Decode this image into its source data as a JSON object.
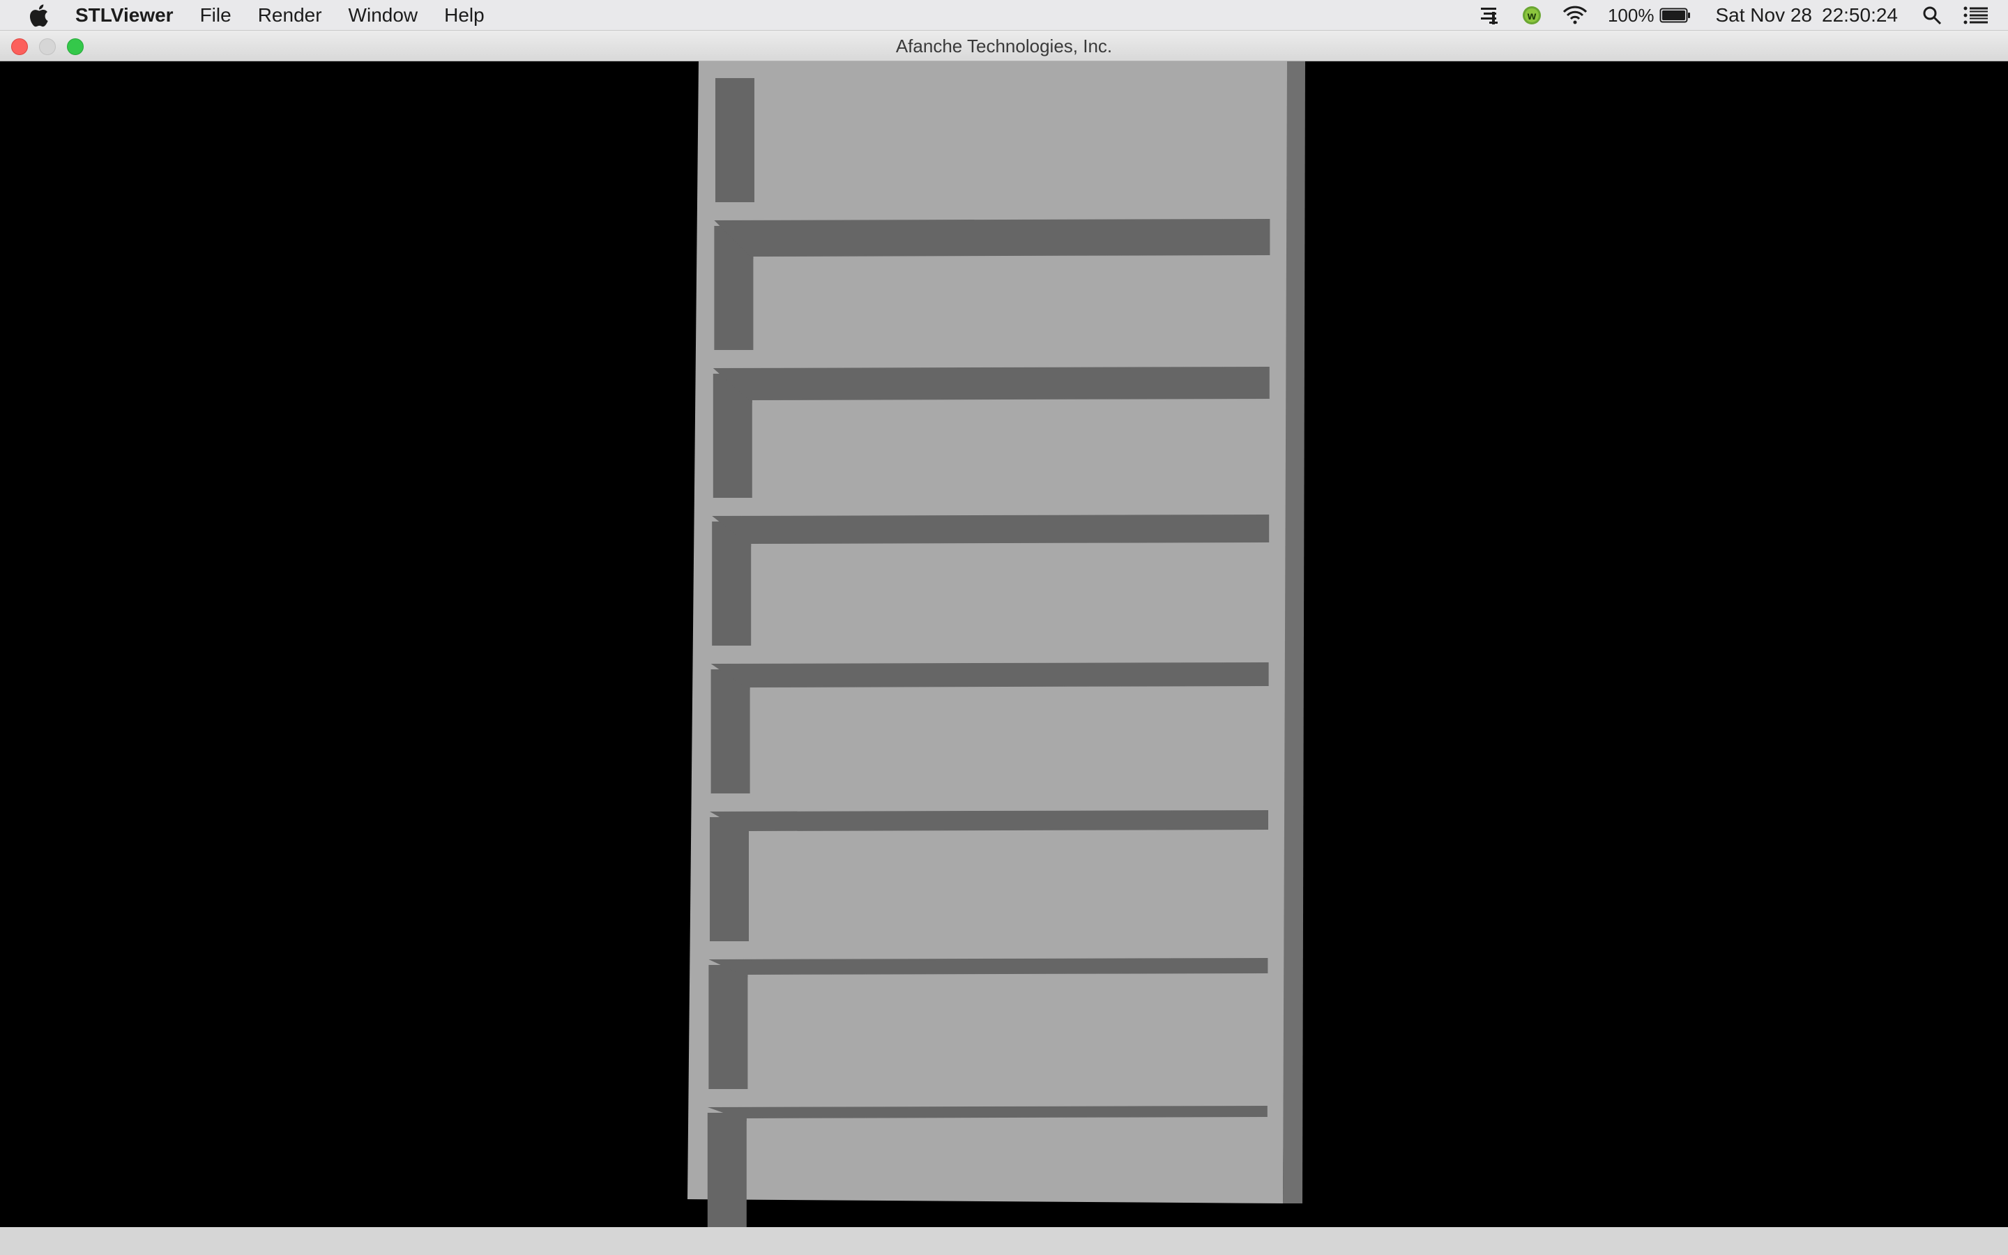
{
  "menubar": {
    "apple_icon": "apple-logo-icon",
    "app_name": "STLViewer",
    "items": [
      "File",
      "Render",
      "Window",
      "Help"
    ],
    "status": {
      "battery_percent": "100%",
      "date": "Sat Nov 28",
      "time": "22:50:24",
      "icons": [
        "cast-icon",
        "w-badge-icon",
        "wifi-icon",
        "battery-icon",
        "search-icon",
        "list-icon"
      ]
    }
  },
  "window": {
    "title": "Afanche Technologies, Inc."
  },
  "viewport": {
    "background": "#000000",
    "model_face_color": "#a9a9a9",
    "model_shade_color": "#666666",
    "model_edge_color": "#707070",
    "shelf_count": 8
  }
}
